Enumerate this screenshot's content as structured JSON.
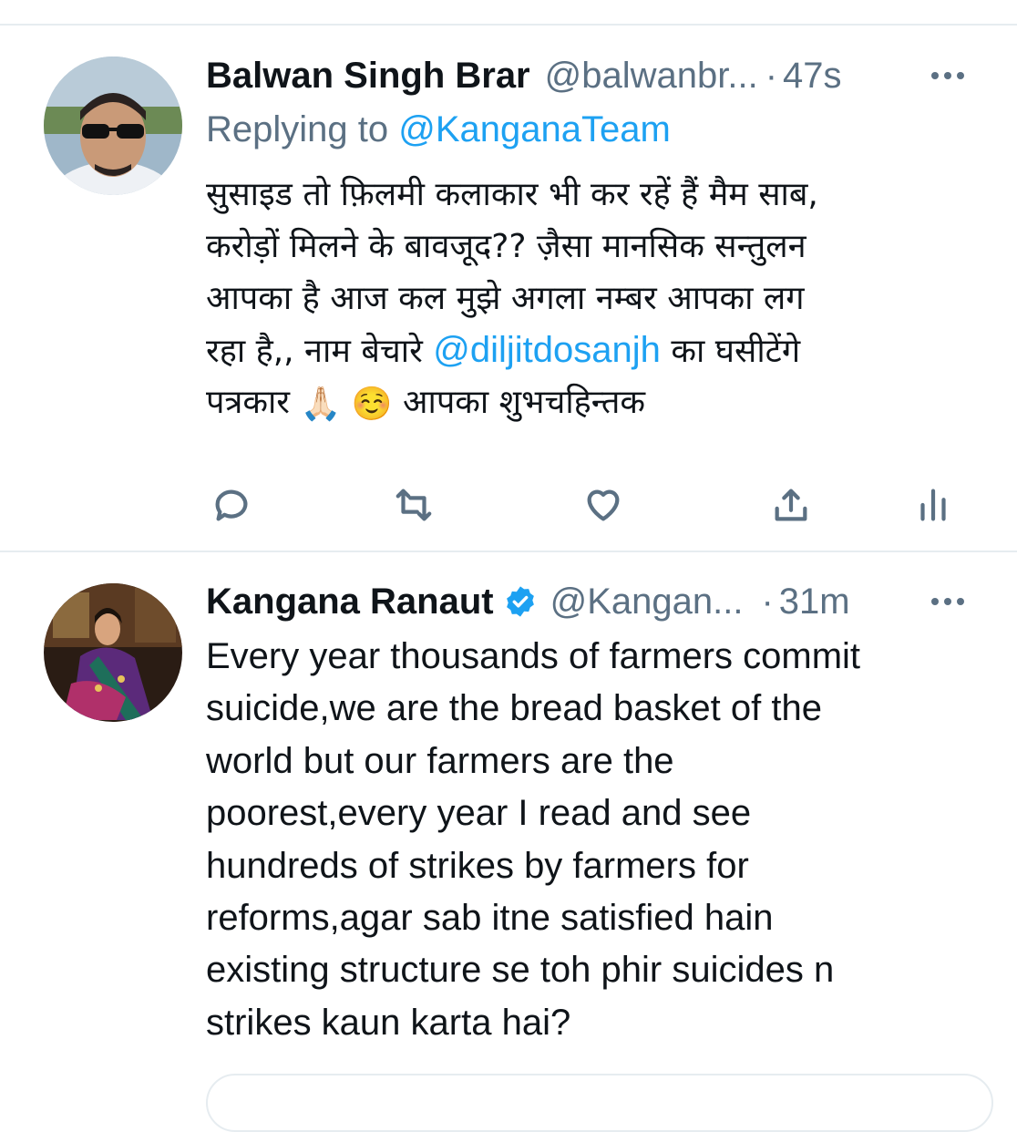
{
  "tweets": [
    {
      "author_name": "Balwan Singh Brar",
      "handle": "@balwanbr...",
      "separator": "·",
      "time": "47s",
      "replying_prefix": "Replying to ",
      "replying_to": "@KanganaTeam",
      "lines": [
        "सुसाइड तो फ़िलमी कलाकार भी कर रहें हैं मैम साब,",
        "करोड़ों मिलने के बावजूद?? ज़ैसा मानसिक सन्तुलन",
        "आपका है आज कल मुझे अगला नम्बर आपका लग",
        "रहा है,, नाम बेचारे ",
        "पत्रकार ",
        " आपका शुभचहिन्तक"
      ],
      "inline_mention": "@diljitdosanjh",
      "after_mention": " का घसीटेंगे",
      "emojis": [
        "🙏🏻",
        "☺️"
      ],
      "actions": [
        "reply-icon",
        "retweet-icon",
        "like-icon",
        "share-icon",
        "analytics-icon"
      ]
    },
    {
      "author_name": "Kangana Ranaut",
      "verified": true,
      "handle": "@Kangan...",
      "separator": "·",
      "time": "31m",
      "lines": [
        "Every year thousands of farmers commit",
        "suicide,we are the bread basket of the",
        "world but our farmers are the",
        "poorest,every year I read and see",
        "hundreds of strikes by farmers for",
        "reforms,agar sab itne satisfied hain",
        "existing structure se toh phir suicides n",
        "strikes kaun karta hai?"
      ]
    }
  ],
  "colors": {
    "link": "#1da1f2",
    "muted": "#5b7083",
    "text": "#0f1419",
    "divider": "#e6ecf0"
  }
}
